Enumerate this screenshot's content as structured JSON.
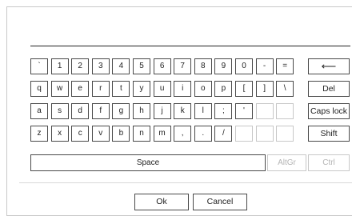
{
  "input": {
    "value": ""
  },
  "keyboard": {
    "row1": [
      "`",
      "1",
      "2",
      "3",
      "4",
      "5",
      "6",
      "7",
      "8",
      "9",
      "0",
      "-",
      "=",
      "⟵"
    ],
    "row2": [
      "q",
      "w",
      "e",
      "r",
      "t",
      "y",
      "u",
      "i",
      "o",
      "p",
      "[",
      "]",
      "\\",
      "Del"
    ],
    "row3": [
      "a",
      "s",
      "d",
      "f",
      "g",
      "h",
      "j",
      "k",
      "l",
      ";",
      "'",
      "",
      "",
      "Caps lock"
    ],
    "row4": [
      "z",
      "x",
      "c",
      "v",
      "b",
      "n",
      "m",
      ",",
      ".",
      "/",
      "",
      "",
      "",
      "Shift"
    ],
    "space": "Space",
    "altgr": "AltGr",
    "ctrl": "Ctrl"
  },
  "footer": {
    "ok": "Ok",
    "cancel": "Cancel"
  }
}
